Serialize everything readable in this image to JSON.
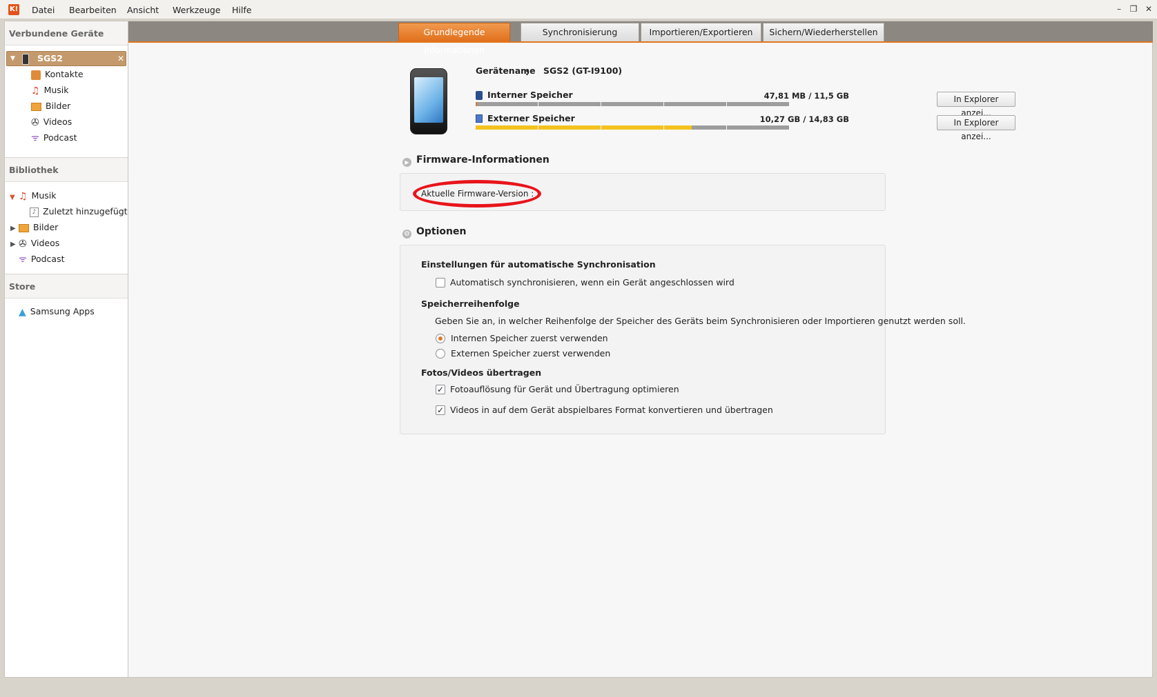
{
  "menu": [
    "Datei",
    "Bearbeiten",
    "Ansicht",
    "Werkzeuge",
    "Hilfe"
  ],
  "app_logo": "K!",
  "window_controls": {
    "minimize": "–",
    "restore": "❐",
    "close": "✕"
  },
  "sidebar": {
    "connected_header": "Verbundene Geräte",
    "device": {
      "name": "SGS2",
      "close": "✕"
    },
    "device_items": [
      {
        "label": "Kontakte",
        "icon": "contacts-icon"
      },
      {
        "label": "Musik",
        "icon": "music-icon"
      },
      {
        "label": "Bilder",
        "icon": "pictures-icon"
      },
      {
        "label": "Videos",
        "icon": "videos-icon"
      },
      {
        "label": "Podcast",
        "icon": "podcast-icon"
      }
    ],
    "library_header": "Bibliothek",
    "library_items": [
      {
        "label": "Musik",
        "icon": "music-icon",
        "expanded": true
      },
      {
        "label": "Zuletzt hinzugefügt",
        "icon": "recent-icon"
      },
      {
        "label": "Bilder",
        "icon": "pictures-icon",
        "expanded": false
      },
      {
        "label": "Videos",
        "icon": "videos-icon",
        "expanded": false
      },
      {
        "label": "Podcast",
        "icon": "podcast-icon"
      }
    ],
    "store_header": "Store",
    "store_items": [
      {
        "label": "Samsung Apps",
        "icon": "samsung-apps-icon"
      }
    ]
  },
  "tabs": [
    {
      "label": "Grundlegende Informationen",
      "active": true
    },
    {
      "label": "Synchronisierung",
      "active": false
    },
    {
      "label": "Importieren/Exportieren",
      "active": false
    },
    {
      "label": "Sichern/Wiederherstellen",
      "active": false
    }
  ],
  "device_info": {
    "name_label": "Gerätename",
    "name_sep": ":",
    "name_value": "SGS2 (GT-I9100)",
    "internal": {
      "label": "Interner Speicher",
      "usage": "47,81 MB / 11,5 GB",
      "fraction": 0.004,
      "button": "In Explorer anzei..."
    },
    "external": {
      "label": "Externer Speicher",
      "usage": "10,27 GB / 14,83 GB",
      "fraction": 0.69,
      "button": "In Explorer anzei..."
    }
  },
  "firmware": {
    "title": "Firmware-Informationen",
    "current_label": "Aktuelle Firmware-Version :"
  },
  "options": {
    "title": "Optionen",
    "auto_sync_heading": "Einstellungen für automatische Synchronisation",
    "auto_sync_label": "Automatisch synchronisieren, wenn ein Gerät angeschlossen wird",
    "auto_sync_checked": false,
    "storage_heading": "Speicherreihenfolge",
    "storage_desc": "Geben Sie an, in welcher Reihenfolge der Speicher des Geräts beim Synchronisieren oder Importieren genutzt werden soll.",
    "storage_internal": "Internen Speicher zuerst verwenden",
    "storage_external": "Externen Speicher zuerst verwenden",
    "transfer_heading": "Fotos/Videos übertragen",
    "photo_opt": "Fotoauflösung für Gerät und Übertragung optimieren",
    "video_opt": "Videos in auf dem Gerät abspielbares Format konvertieren und übertragen",
    "checkmark": "✓"
  },
  "colors": {
    "accent": "#e2761e",
    "internal_fill": "#e2761e",
    "external_fill": "#f4c21f",
    "highlight": "#e8141b"
  }
}
